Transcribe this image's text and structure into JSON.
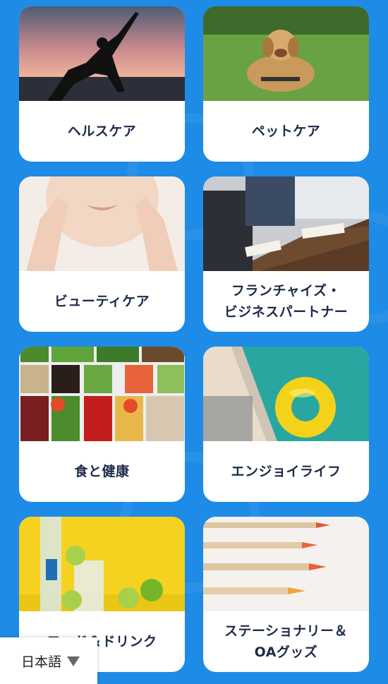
{
  "categories": [
    {
      "label": "ヘルスケア",
      "image": "yoga-silhouette-sunset"
    },
    {
      "label": "ペットケア",
      "image": "golden-retriever-grass"
    },
    {
      "label": "ビューティケア",
      "image": "woman-face-skin-care"
    },
    {
      "label": "フランチャイズ・\nビジネスパートナー",
      "image": "business-meeting-table"
    },
    {
      "label": "食と健康",
      "image": "vegetable-trays"
    },
    {
      "label": "エンジョイライフ",
      "image": "pool-float-ring"
    },
    {
      "label": "フード＆ドリンク",
      "image": "lemon-water-drinks"
    },
    {
      "label": "ステーショナリー＆\nOAグッズ",
      "image": "colored-pencils"
    }
  ],
  "language_selector": {
    "label": "日本語"
  },
  "colors": {
    "background": "#1e8be6",
    "card": "#ffffff",
    "label_text": "#1c2b48"
  }
}
